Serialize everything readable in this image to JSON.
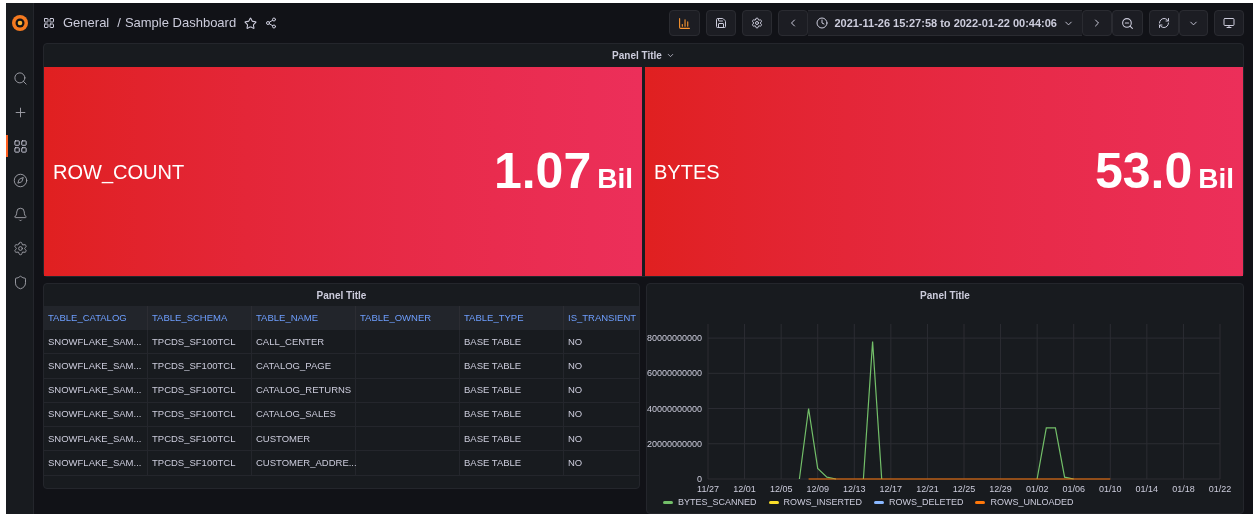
{
  "breadcrumb": {
    "folder": "General",
    "separator": "/",
    "title": "Sample Dashboard"
  },
  "time_range": {
    "label": "2021-11-26 15:27:58 to 2022-01-22 00:44:06"
  },
  "sidebar": {
    "items": [
      {
        "kind": "search",
        "selected": false
      },
      {
        "kind": "create",
        "selected": false
      },
      {
        "kind": "dashboards",
        "selected": true
      },
      {
        "kind": "explore",
        "selected": false
      },
      {
        "kind": "alerting",
        "selected": false
      },
      {
        "kind": "configuration",
        "selected": false
      },
      {
        "kind": "admin",
        "selected": false
      }
    ]
  },
  "row": {
    "title": "Panel Title",
    "expanded": true
  },
  "stats": [
    {
      "label": "ROW_COUNT",
      "value": "1.07",
      "unit": "Bil"
    },
    {
      "label": "BYTES",
      "value": "53.0",
      "unit": "Bil"
    }
  ],
  "table_panel": {
    "title": "Panel Title",
    "columns": [
      "TABLE_CATALOG",
      "TABLE_SCHEMA",
      "TABLE_NAME",
      "TABLE_OWNER",
      "TABLE_TYPE",
      "IS_TRANSIENT"
    ],
    "rows": [
      [
        "SNOWFLAKE_SAM...",
        "TPCDS_SF100TCL",
        "CALL_CENTER",
        "",
        "BASE TABLE",
        "NO"
      ],
      [
        "SNOWFLAKE_SAM...",
        "TPCDS_SF100TCL",
        "CATALOG_PAGE",
        "",
        "BASE TABLE",
        "NO"
      ],
      [
        "SNOWFLAKE_SAM...",
        "TPCDS_SF100TCL",
        "CATALOG_RETURNS",
        "",
        "BASE TABLE",
        "NO"
      ],
      [
        "SNOWFLAKE_SAM...",
        "TPCDS_SF100TCL",
        "CATALOG_SALES",
        "",
        "BASE TABLE",
        "NO"
      ],
      [
        "SNOWFLAKE_SAM...",
        "TPCDS_SF100TCL",
        "CUSTOMER",
        "",
        "BASE TABLE",
        "NO"
      ],
      [
        "SNOWFLAKE_SAM...",
        "TPCDS_SF100TCL",
        "CUSTOMER_ADDRE...",
        "",
        "BASE TABLE",
        "NO"
      ]
    ]
  },
  "chart_panel": {
    "title": "Panel Title",
    "chart_data": {
      "type": "line",
      "categories": [
        "11/27",
        null,
        null,
        null,
        "12/01",
        null,
        null,
        null,
        "12/05",
        null,
        null,
        null,
        "12/09",
        null,
        null,
        null,
        "12/13",
        null,
        null,
        null,
        "12/17",
        null,
        null,
        null,
        "12/21",
        null,
        null,
        null,
        "12/25",
        null,
        null,
        null,
        "12/29",
        null,
        null,
        null,
        "01/02",
        null,
        null,
        null,
        "01/06",
        null,
        null,
        null,
        "01/10",
        null,
        null,
        null,
        "01/14",
        null,
        null,
        null,
        "01/18",
        null,
        null,
        null,
        "01/22"
      ],
      "series": [
        {
          "name": "BYTES_SCANNED",
          "color": "#73bf69",
          "values": [
            null,
            null,
            null,
            null,
            null,
            null,
            null,
            null,
            null,
            null,
            0,
            40000000000,
            6000000000,
            1000000000,
            0,
            null,
            null,
            0,
            78000000000,
            0,
            null,
            null,
            null,
            null,
            null,
            null,
            null,
            null,
            null,
            null,
            null,
            null,
            null,
            null,
            null,
            null,
            0,
            29000000000,
            29000000000,
            1000000000,
            0,
            null,
            null,
            null,
            null,
            null,
            null,
            null,
            null,
            null,
            null,
            null,
            null,
            null,
            null,
            null,
            null
          ]
        },
        {
          "name": "ROWS_INSERTED",
          "color": "#fade2a",
          "values": [
            null,
            null,
            null,
            null,
            null,
            null,
            null,
            null,
            null,
            null,
            null,
            null,
            null,
            null,
            null,
            null,
            null,
            null,
            null,
            null,
            null,
            null,
            null,
            null,
            null,
            null,
            null,
            null,
            null,
            null,
            null,
            null,
            null,
            null,
            null,
            null,
            null,
            null,
            null,
            null,
            null,
            null,
            null,
            null,
            null,
            null,
            null,
            null,
            null,
            null,
            null,
            null,
            null,
            null,
            null,
            null,
            null
          ]
        },
        {
          "name": "ROWS_DELETED",
          "color": "#8ab8ff",
          "values": [
            null,
            null,
            null,
            null,
            null,
            null,
            null,
            null,
            null,
            null,
            null,
            null,
            null,
            null,
            null,
            null,
            null,
            null,
            null,
            null,
            null,
            null,
            null,
            null,
            null,
            null,
            null,
            null,
            null,
            null,
            null,
            null,
            null,
            null,
            null,
            null,
            null,
            null,
            null,
            null,
            null,
            null,
            null,
            null,
            null,
            null,
            null,
            null,
            null,
            null,
            null,
            null,
            null,
            null,
            null,
            null,
            null
          ]
        },
        {
          "name": "ROWS_UNLOADED",
          "color": "#ff780a",
          "values": [
            null,
            null,
            null,
            null,
            null,
            null,
            null,
            null,
            null,
            null,
            null,
            0,
            0,
            0,
            0,
            0,
            0,
            0,
            0,
            0,
            0,
            0,
            0,
            0,
            0,
            0,
            0,
            0,
            0,
            0,
            0,
            0,
            0,
            0,
            0,
            0,
            0,
            0,
            0,
            0,
            0,
            0,
            0,
            0,
            0,
            null,
            null,
            null,
            null,
            null,
            null,
            null,
            null,
            null,
            null,
            null,
            null
          ]
        }
      ],
      "ylim": [
        0,
        88000000000
      ],
      "grid": true,
      "yticks": [
        {
          "value": 0,
          "label": "0"
        },
        {
          "value": 20000000000,
          "label": "20000000000"
        },
        {
          "value": 40000000000,
          "label": "40000000000"
        },
        {
          "value": 60000000000,
          "label": "60000000000"
        },
        {
          "value": 80000000000,
          "label": "80000000000"
        }
      ]
    }
  }
}
